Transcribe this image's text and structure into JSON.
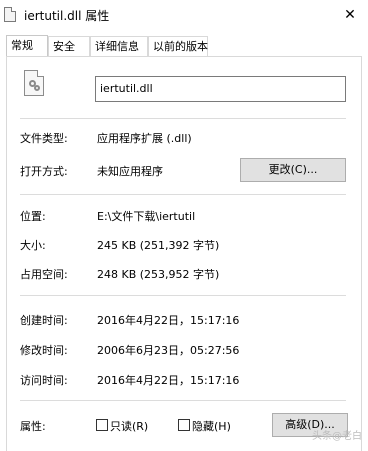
{
  "window": {
    "title": "iertutil.dll 属性",
    "close_glyph": "✕",
    "file_icon": "dll-file-icon"
  },
  "tabs": [
    {
      "label": "常规",
      "active": true
    },
    {
      "label": "安全",
      "active": false
    },
    {
      "label": "详细信息",
      "active": false
    },
    {
      "label": "以前的版本",
      "active": false
    }
  ],
  "general": {
    "file_name": "iertutil.dll",
    "file_type": {
      "label": "文件类型:",
      "value": "应用程序扩展 (.dll)"
    },
    "opens_with": {
      "label": "打开方式:",
      "value": "未知应用程序",
      "button": "更改(C)..."
    },
    "location": {
      "label": "位置:",
      "value": "E:\\文件下载\\iertutil"
    },
    "size": {
      "label": "大小:",
      "value": "245 KB (251,392 字节)"
    },
    "size_on_disk": {
      "label": "占用空间:",
      "value": "248 KB (253,952 字节)"
    },
    "created": {
      "label": "创建时间:",
      "value": "2016年4月22日，15:17:16"
    },
    "modified": {
      "label": "修改时间:",
      "value": "2006年6月23日，05:27:56"
    },
    "accessed": {
      "label": "访问时间:",
      "value": "2016年4月22日，15:17:16"
    },
    "attributes": {
      "label": "属性:",
      "readonly": {
        "label": "只读(R)",
        "checked": false
      },
      "hidden": {
        "label": "隐藏(H)",
        "checked": false
      },
      "advanced_button": "高级(D)..."
    }
  },
  "watermark": "头条@老白"
}
